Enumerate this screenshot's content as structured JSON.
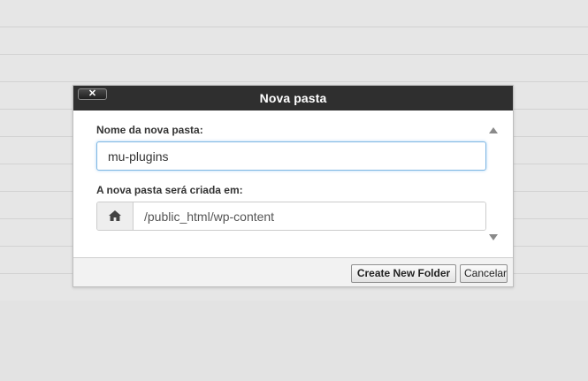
{
  "dialog": {
    "title": "Nova pasta",
    "close_label": "✕"
  },
  "form": {
    "name_label": "Nome da nova pasta:",
    "name_value": "mu-plugins",
    "location_label": "A nova pasta será criada em:",
    "location_value": "/public_html/wp-content",
    "location_icon": "home-icon"
  },
  "footer": {
    "create_label": "Create New Folder",
    "cancel_label": "Cancelar"
  },
  "colors": {
    "titlebar": "#2f2f2f",
    "focus_border": "#7fb7e3"
  }
}
